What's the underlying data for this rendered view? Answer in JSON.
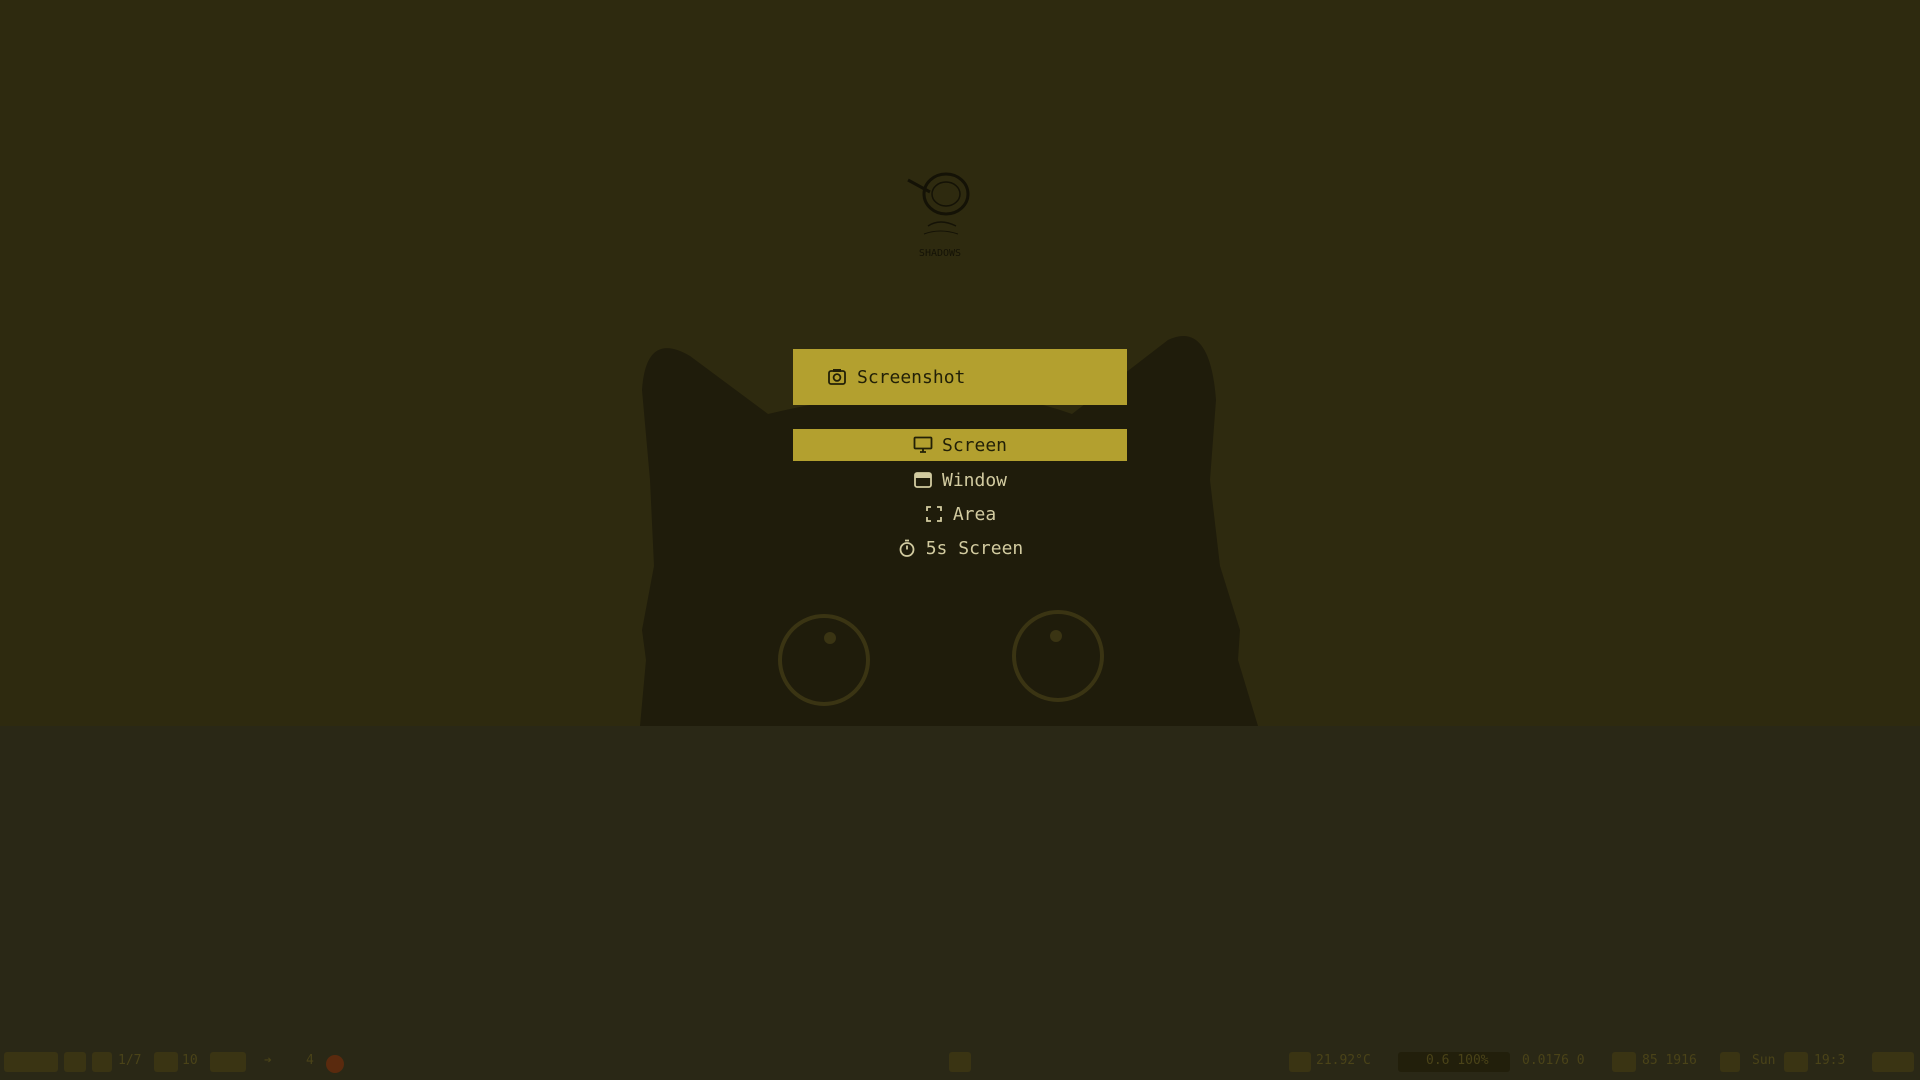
{
  "logo": {
    "caption": "SHADOWS"
  },
  "menu": {
    "title": "Screenshot",
    "title_icon": "camera-icon",
    "items": [
      {
        "label": "Screen",
        "icon": "monitor-icon",
        "selected": true
      },
      {
        "label": "Window",
        "icon": "window-icon",
        "selected": false
      },
      {
        "label": "Area",
        "icon": "area-select-icon",
        "selected": false
      },
      {
        "label": "5s Screen",
        "icon": "timer-icon",
        "selected": false
      }
    ]
  },
  "colors": {
    "accent": "#b3a02f",
    "wallpaper": "#2e2a0f",
    "floor": "#2a2816",
    "menu_text": "#d2cba0"
  },
  "bar": {
    "left": {
      "workspace": "1/7",
      "tag": "10",
      "count": "4"
    },
    "right": {
      "cpu": "21.92°C",
      "mem": "0.6 100%",
      "net": "0.0176 0",
      "disk": "85 1916",
      "date": "Sun",
      "time": "19:3"
    }
  }
}
